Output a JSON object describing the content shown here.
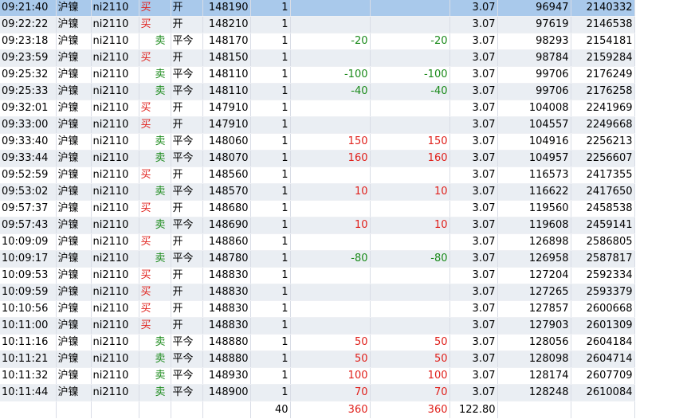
{
  "rows": [
    {
      "time": "09:21:40",
      "name": "沪镍",
      "code": "ni2110",
      "dir": "买",
      "offset": "开",
      "price": "148190",
      "qty": "1",
      "pl1": "",
      "pl2": "",
      "fee": "3.07",
      "seq": "96947",
      "id": "2140332",
      "selected": true
    },
    {
      "time": "09:22:22",
      "name": "沪镍",
      "code": "ni2110",
      "dir": "买",
      "offset": "开",
      "price": "148210",
      "qty": "1",
      "pl1": "",
      "pl2": "",
      "fee": "3.07",
      "seq": "97619",
      "id": "2146538"
    },
    {
      "time": "09:23:18",
      "name": "沪镍",
      "code": "ni2110",
      "dir": "卖",
      "offset": "平今",
      "price": "148170",
      "qty": "1",
      "pl1": "-20",
      "pl2": "-20",
      "fee": "3.07",
      "seq": "98293",
      "id": "2154181"
    },
    {
      "time": "09:23:59",
      "name": "沪镍",
      "code": "ni2110",
      "dir": "买",
      "offset": "开",
      "price": "148150",
      "qty": "1",
      "pl1": "",
      "pl2": "",
      "fee": "3.07",
      "seq": "98784",
      "id": "2159284"
    },
    {
      "time": "09:25:32",
      "name": "沪镍",
      "code": "ni2110",
      "dir": "卖",
      "offset": "平今",
      "price": "148110",
      "qty": "1",
      "pl1": "-100",
      "pl2": "-100",
      "fee": "3.07",
      "seq": "99706",
      "id": "2176249"
    },
    {
      "time": "09:25:33",
      "name": "沪镍",
      "code": "ni2110",
      "dir": "卖",
      "offset": "平今",
      "price": "148110",
      "qty": "1",
      "pl1": "-40",
      "pl2": "-40",
      "fee": "3.07",
      "seq": "99706",
      "id": "2176258"
    },
    {
      "time": "09:32:01",
      "name": "沪镍",
      "code": "ni2110",
      "dir": "买",
      "offset": "开",
      "price": "147910",
      "qty": "1",
      "pl1": "",
      "pl2": "",
      "fee": "3.07",
      "seq": "104008",
      "id": "2241969"
    },
    {
      "time": "09:33:00",
      "name": "沪镍",
      "code": "ni2110",
      "dir": "买",
      "offset": "开",
      "price": "147910",
      "qty": "1",
      "pl1": "",
      "pl2": "",
      "fee": "3.07",
      "seq": "104557",
      "id": "2249668"
    },
    {
      "time": "09:33:40",
      "name": "沪镍",
      "code": "ni2110",
      "dir": "卖",
      "offset": "平今",
      "price": "148060",
      "qty": "1",
      "pl1": "150",
      "pl2": "150",
      "fee": "3.07",
      "seq": "104916",
      "id": "2256213"
    },
    {
      "time": "09:33:44",
      "name": "沪镍",
      "code": "ni2110",
      "dir": "卖",
      "offset": "平今",
      "price": "148070",
      "qty": "1",
      "pl1": "160",
      "pl2": "160",
      "fee": "3.07",
      "seq": "104957",
      "id": "2256607"
    },
    {
      "time": "09:52:59",
      "name": "沪镍",
      "code": "ni2110",
      "dir": "买",
      "offset": "开",
      "price": "148560",
      "qty": "1",
      "pl1": "",
      "pl2": "",
      "fee": "3.07",
      "seq": "116573",
      "id": "2417355"
    },
    {
      "time": "09:53:02",
      "name": "沪镍",
      "code": "ni2110",
      "dir": "卖",
      "offset": "平今",
      "price": "148570",
      "qty": "1",
      "pl1": "10",
      "pl2": "10",
      "fee": "3.07",
      "seq": "116622",
      "id": "2417650"
    },
    {
      "time": "09:57:37",
      "name": "沪镍",
      "code": "ni2110",
      "dir": "买",
      "offset": "开",
      "price": "148680",
      "qty": "1",
      "pl1": "",
      "pl2": "",
      "fee": "3.07",
      "seq": "119560",
      "id": "2458538"
    },
    {
      "time": "09:57:43",
      "name": "沪镍",
      "code": "ni2110",
      "dir": "卖",
      "offset": "平今",
      "price": "148690",
      "qty": "1",
      "pl1": "10",
      "pl2": "10",
      "fee": "3.07",
      "seq": "119608",
      "id": "2459141"
    },
    {
      "time": "10:09:09",
      "name": "沪镍",
      "code": "ni2110",
      "dir": "买",
      "offset": "开",
      "price": "148860",
      "qty": "1",
      "pl1": "",
      "pl2": "",
      "fee": "3.07",
      "seq": "126898",
      "id": "2586805"
    },
    {
      "time": "10:09:17",
      "name": "沪镍",
      "code": "ni2110",
      "dir": "卖",
      "offset": "平今",
      "price": "148780",
      "qty": "1",
      "pl1": "-80",
      "pl2": "-80",
      "fee": "3.07",
      "seq": "126958",
      "id": "2587817"
    },
    {
      "time": "10:09:53",
      "name": "沪镍",
      "code": "ni2110",
      "dir": "买",
      "offset": "开",
      "price": "148830",
      "qty": "1",
      "pl1": "",
      "pl2": "",
      "fee": "3.07",
      "seq": "127204",
      "id": "2592334"
    },
    {
      "time": "10:09:59",
      "name": "沪镍",
      "code": "ni2110",
      "dir": "买",
      "offset": "开",
      "price": "148830",
      "qty": "1",
      "pl1": "",
      "pl2": "",
      "fee": "3.07",
      "seq": "127265",
      "id": "2593379"
    },
    {
      "time": "10:10:56",
      "name": "沪镍",
      "code": "ni2110",
      "dir": "买",
      "offset": "开",
      "price": "148830",
      "qty": "1",
      "pl1": "",
      "pl2": "",
      "fee": "3.07",
      "seq": "127857",
      "id": "2600668"
    },
    {
      "time": "10:11:00",
      "name": "沪镍",
      "code": "ni2110",
      "dir": "买",
      "offset": "开",
      "price": "148830",
      "qty": "1",
      "pl1": "",
      "pl2": "",
      "fee": "3.07",
      "seq": "127903",
      "id": "2601309"
    },
    {
      "time": "10:11:16",
      "name": "沪镍",
      "code": "ni2110",
      "dir": "卖",
      "offset": "平今",
      "price": "148880",
      "qty": "1",
      "pl1": "50",
      "pl2": "50",
      "fee": "3.07",
      "seq": "128056",
      "id": "2604184"
    },
    {
      "time": "10:11:21",
      "name": "沪镍",
      "code": "ni2110",
      "dir": "卖",
      "offset": "平今",
      "price": "148880",
      "qty": "1",
      "pl1": "50",
      "pl2": "50",
      "fee": "3.07",
      "seq": "128098",
      "id": "2604714"
    },
    {
      "time": "10:11:32",
      "name": "沪镍",
      "code": "ni2110",
      "dir": "卖",
      "offset": "平今",
      "price": "148930",
      "qty": "1",
      "pl1": "100",
      "pl2": "100",
      "fee": "3.07",
      "seq": "128174",
      "id": "2607709"
    },
    {
      "time": "10:11:44",
      "name": "沪镍",
      "code": "ni2110",
      "dir": "卖",
      "offset": "平今",
      "price": "148900",
      "qty": "1",
      "pl1": "70",
      "pl2": "70",
      "fee": "3.07",
      "seq": "128248",
      "id": "2610084"
    }
  ],
  "totals": {
    "qty": "40",
    "pl1": "360",
    "pl2": "360",
    "fee": "122.80"
  },
  "colors": {
    "buy": "#e0201b",
    "sell": "#1a8a1a",
    "selected": "#a9c9eb",
    "stripe": "#eaeef3"
  }
}
